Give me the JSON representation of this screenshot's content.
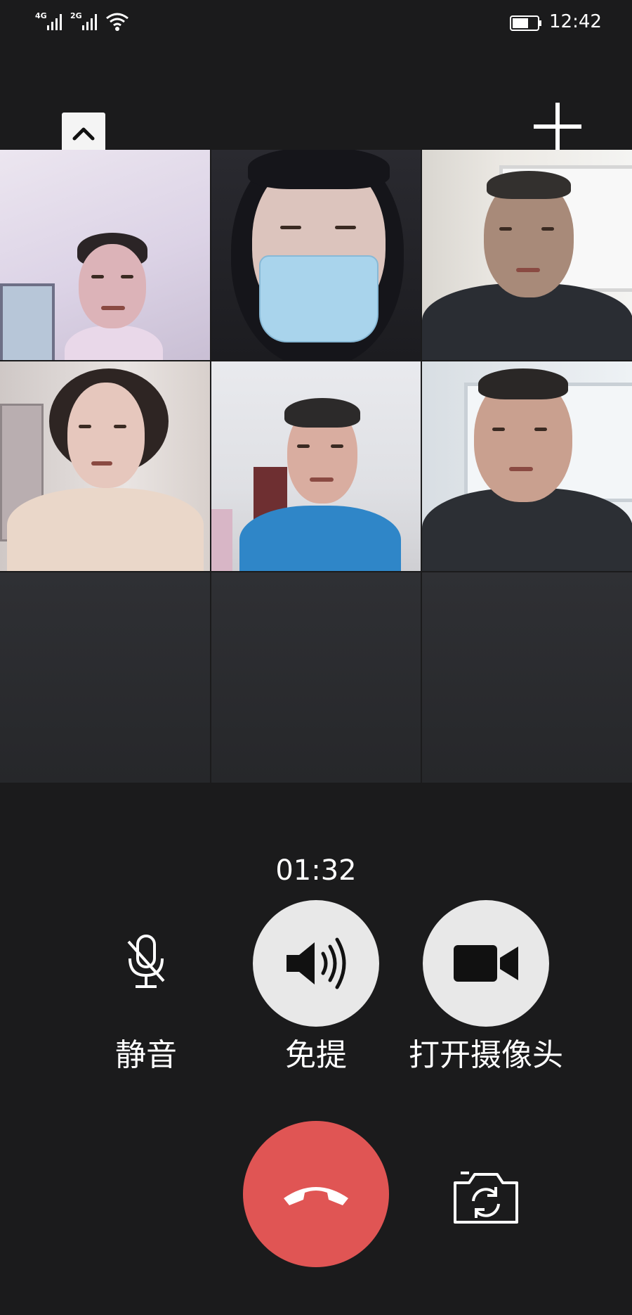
{
  "status_bar": {
    "network_1": "4G",
    "network_2": "2G",
    "time": "12:42",
    "icons": [
      "signal-icon",
      "signal-icon",
      "wifi-icon",
      "battery-icon"
    ]
  },
  "top_controls": {
    "collapse_icon": "chevron-up-icon",
    "add_icon": "plus-icon"
  },
  "participants": [
    {
      "tile": 1,
      "video": "man-white-room"
    },
    {
      "tile": 2,
      "video": "woman-blue-mask-hood"
    },
    {
      "tile": 3,
      "video": "man-dark-uniform"
    },
    {
      "tile": 4,
      "video": "woman-beige-top"
    },
    {
      "tile": 5,
      "video": "man-blue-jacket"
    },
    {
      "tile": 6,
      "video": "man-dark-jacket"
    }
  ],
  "empty_slots": 3,
  "call": {
    "duration": "01:32"
  },
  "controls": {
    "mute_label": "静音",
    "speaker_label": "免提",
    "camera_label": "打开摄像头",
    "mute_icon": "mic-off-icon",
    "speaker_icon": "speaker-icon",
    "camera_icon": "video-camera-icon",
    "hangup_icon": "phone-hangup-icon",
    "flip_icon": "camera-flip-icon"
  },
  "colors": {
    "background": "#1b1b1c",
    "hangup": "#e05554",
    "control_circle": "#e8e8e8",
    "empty_tile": "#2f3034"
  }
}
